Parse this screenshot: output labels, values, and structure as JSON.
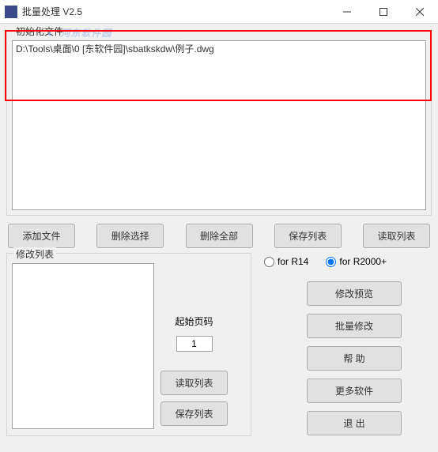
{
  "window": {
    "title": "批量处理 V2.5"
  },
  "watermark": "河东软件园",
  "groupbox1": {
    "legend": "初始化文件",
    "filelist_items": [
      "D:\\Tools\\桌面\\0 [东软件园]\\sbatkskdw\\例子.dwg"
    ]
  },
  "toolbar": {
    "add_file": "添加文件",
    "del_selected": "删除选择",
    "del_all": "删除全部",
    "save_list": "保存列表",
    "read_list": "读取列表"
  },
  "groupbox2": {
    "legend": "修改列表"
  },
  "page": {
    "label": "起始页码",
    "value": "1"
  },
  "left_buttons": {
    "read_list": "读取列表",
    "save_list": "保存列表"
  },
  "radios": {
    "r14": "for R14",
    "r2000": "for R2000+"
  },
  "right_buttons": {
    "preview": "修改预览",
    "batch": "批量修改",
    "help": "帮   助",
    "more": "更多软件",
    "exit": "退   出"
  }
}
